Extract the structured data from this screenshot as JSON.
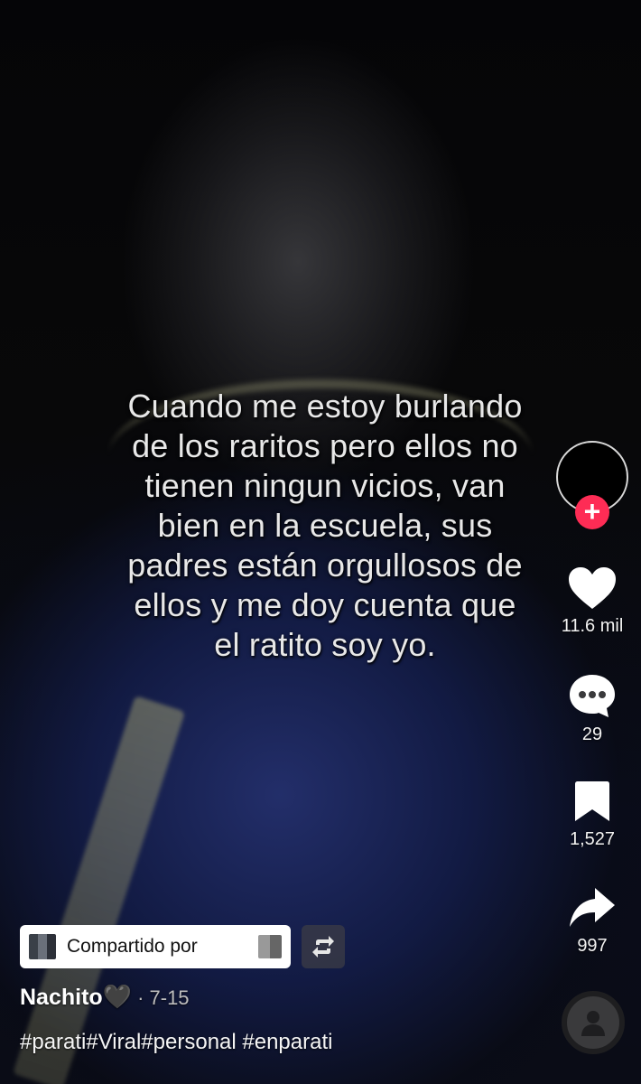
{
  "video": {
    "caption_overlay": "Cuando me estoy burlando\nde los raritos pero ellos no\ntienen ningun vicios, van\nbien en la escuela, sus\npadres están orgullosos de\nellos y me doy cuenta que\nel ratito soy yo."
  },
  "actions": {
    "follow_symbol": "+",
    "likes": "11.6 mil",
    "comments": "29",
    "saves": "1,527",
    "shares": "997"
  },
  "shared": {
    "label": "Compartido por"
  },
  "post": {
    "author": "Nachito",
    "author_emoji": "🖤",
    "date": "· 7-15",
    "hashtags": "#parati#Viral#personal #enparati"
  },
  "icons": {
    "like": "heart-icon",
    "comment": "comment-bubble-icon",
    "save": "bookmark-icon",
    "share": "share-arrow-icon",
    "repost": "repost-icon",
    "music": "music-disc-icon"
  },
  "colors": {
    "follow_accent": "#fe2c55",
    "icon_white": "#ffffff"
  }
}
